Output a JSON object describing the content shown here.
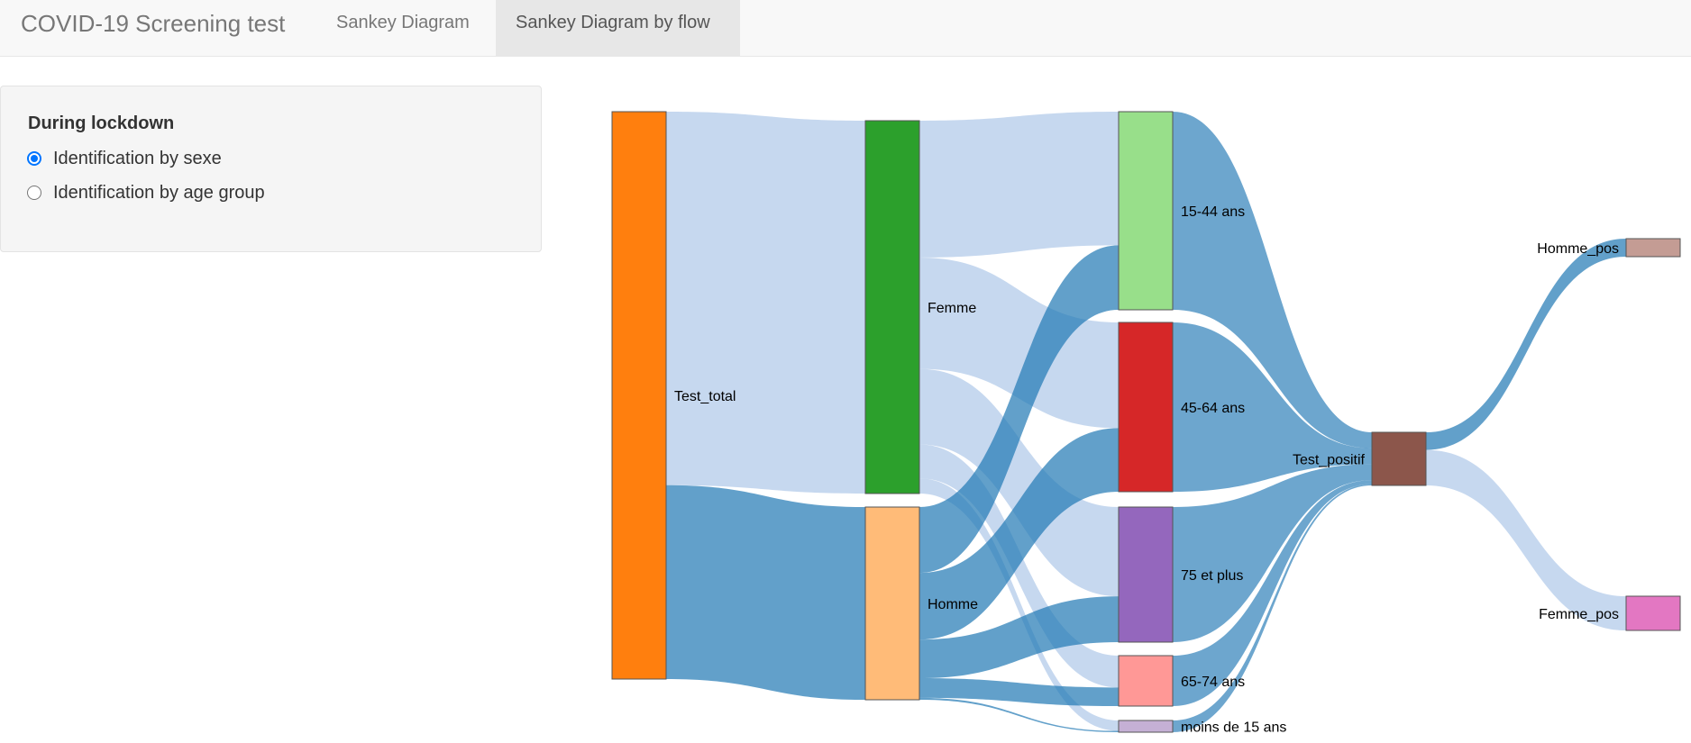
{
  "app": {
    "title": "COVID-19 Screening test"
  },
  "nav": {
    "tabs": [
      {
        "label": "Sankey Diagram",
        "active": false
      },
      {
        "label": "Sankey Diagram by flow",
        "active": true
      }
    ]
  },
  "sidebar": {
    "heading": "During lockdown",
    "options": [
      {
        "label": "Identification by sexe",
        "checked": true
      },
      {
        "label": "Identification by age group",
        "checked": false
      }
    ]
  },
  "colors": {
    "link_light": "#aec7e8",
    "link_dark": "#1f77b4",
    "node_colors": {
      "Test_total": "#ff7f0e",
      "Femme": "#2ca02c",
      "Homme": "#ffbb78",
      "15-44 ans": "#98df8a",
      "45-64 ans": "#d62728",
      "75 et plus": "#9467bd",
      "65-74 ans": "#ff9896",
      "moins de 15 ans": "#c5b0d5",
      "Test_positif": "#8c564b",
      "Homme_pos": "#c49c94",
      "Femme_pos": "#e377c2"
    }
  },
  "chart_data": {
    "type": "sankey",
    "nodes": [
      "Test_total",
      "Femme",
      "Homme",
      "15-44 ans",
      "45-64 ans",
      "75 et plus",
      "65-74 ans",
      "moins de 15 ans",
      "Test_positif",
      "Homme_pos",
      "Femme_pos"
    ],
    "links": [
      {
        "source": "Test_total",
        "target": "Femme",
        "value": 395
      },
      {
        "source": "Test_total",
        "target": "Homme",
        "value": 205
      },
      {
        "source": "Femme",
        "target": "15-44 ans",
        "value": 145
      },
      {
        "source": "Femme",
        "target": "45-64 ans",
        "value": 118
      },
      {
        "source": "Femme",
        "target": "75 et plus",
        "value": 80
      },
      {
        "source": "Femme",
        "target": "65-74 ans",
        "value": 36
      },
      {
        "source": "Femme",
        "target": "moins de 15 ans",
        "value": 16
      },
      {
        "source": "Homme",
        "target": "15-44 ans",
        "value": 70
      },
      {
        "source": "Homme",
        "target": "45-64 ans",
        "value": 71
      },
      {
        "source": "Homme",
        "target": "75 et plus",
        "value": 41
      },
      {
        "source": "Homme",
        "target": "65-74 ans",
        "value": 21
      },
      {
        "source": "Homme",
        "target": "moins de 15 ans",
        "value": 2
      },
      {
        "source": "15-44 ans",
        "target": "Test_positif",
        "value": 12
      },
      {
        "source": "45-64 ans",
        "target": "Test_positif",
        "value": 12
      },
      {
        "source": "75 et plus",
        "target": "Test_positif",
        "value": 12
      },
      {
        "source": "65-74 ans",
        "target": "Test_positif",
        "value": 3
      },
      {
        "source": "moins de 15 ans",
        "target": "Test_positif",
        "value": 1
      },
      {
        "source": "Test_positif",
        "target": "Homme_pos",
        "value": 19
      },
      {
        "source": "Test_positif",
        "target": "Femme_pos",
        "value": 38
      }
    ]
  }
}
